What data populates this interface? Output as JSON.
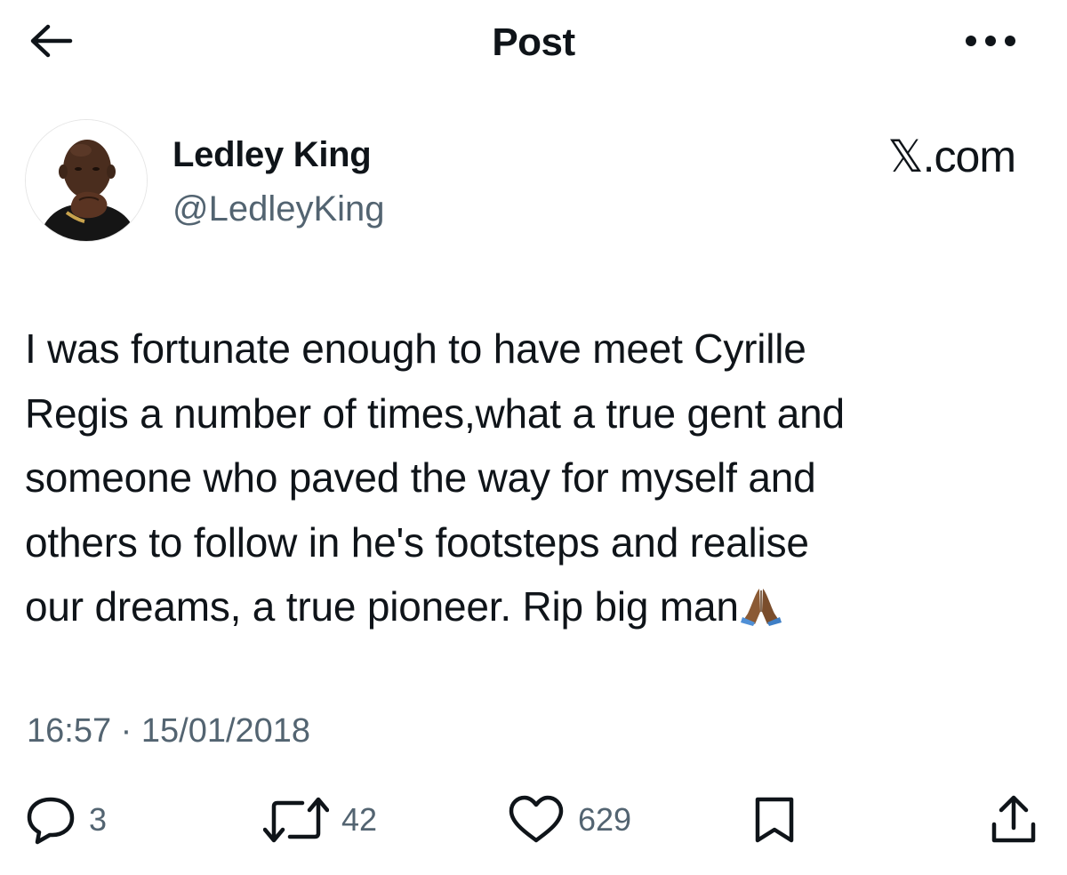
{
  "header": {
    "title": "Post",
    "back_icon": "arrow-left-icon",
    "more_icon": "more-horizontal-icon"
  },
  "author": {
    "name": "Ledley King",
    "handle": "@LedleyKing",
    "avatar_icon": "profile-photo"
  },
  "brand": {
    "label": "𝕏.com"
  },
  "tweet": {
    "text": "I was fortunate enough to have meet Cyrille\nRegis a number of times,what a true gent and\nsomeone who paved the way for myself and\nothers to follow in he's footsteps and realise\nour dreams, a true pioneer. Rip big man",
    "emoji": "folded-hands-icon",
    "timestamp": "16:57 · 15/01/2018"
  },
  "actions": {
    "reply": {
      "icon": "reply-icon",
      "count": "3"
    },
    "repost": {
      "icon": "repost-icon",
      "count": "42"
    },
    "like": {
      "icon": "heart-icon",
      "count": "629"
    },
    "bookmark": {
      "icon": "bookmark-icon"
    },
    "share": {
      "icon": "share-icon"
    }
  },
  "colors": {
    "text_primary": "#0f1419",
    "text_secondary": "#536471",
    "background": "#ffffff"
  }
}
